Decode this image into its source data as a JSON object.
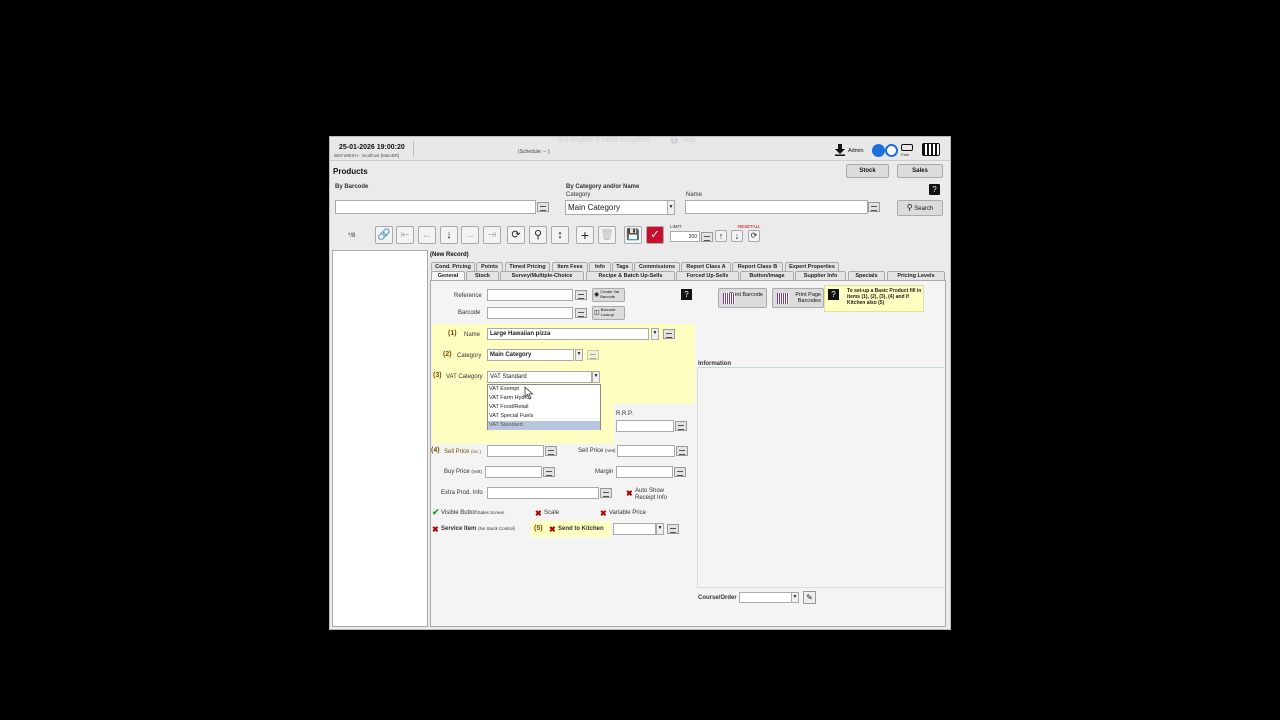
{
  "header": {
    "datetime": "25-01-2026 19:00:20",
    "terminal": "IBM-W9ISH - localhost [MainBR]",
    "schedule": "(Schedule: -- )",
    "language": "EN English (United Kingdom)",
    "help": "Help",
    "admin": "Admin",
    "park": "Park"
  },
  "page": {
    "title": "Products",
    "stock_btn": "Stock",
    "sales_btn": "Sales"
  },
  "search": {
    "by_barcode": "By Barcode",
    "by_category_or_name": "By Category and/or Name",
    "category_label": "Category",
    "category_value": "Main Category",
    "name_label": "Name",
    "search_btn": "Search"
  },
  "toolbar": {
    "record_count": "*/8",
    "limit_label": "LIMIT",
    "limit_value": "200",
    "reset_all": "RESETALL"
  },
  "record": {
    "title": "(New Record)"
  },
  "tabs_row1": [
    "Cond. Pricing",
    "Points",
    "Timed Pricing",
    "Item Fees",
    "Info",
    "Tags",
    "Commissions",
    "Report Class A",
    "Report Class B",
    "Expert Properties"
  ],
  "tabs_row2": [
    "General",
    "Stock",
    "Survey/Multiple-Choice",
    "Recipe & Batch Up-Sells",
    "Forced Up-Sells",
    "Button/Image",
    "Supplier Info",
    "Specials",
    "Pricing Levels"
  ],
  "form": {
    "reference_label": "Reference",
    "barcode_label": "Barcode",
    "create_var_barcode": "Create Var Barcode",
    "barcode_lookup": "Barcode Lookup",
    "n1": "(1)",
    "name_label": "Name",
    "name_value": "Large Hawaiian pizza",
    "n2": "(2)",
    "category_label": "Category",
    "category_value": "Main Category",
    "n3": "(3)",
    "vat_label": "VAT Category",
    "vat_value": "VAT Standard",
    "vat_options": [
      "VAT Exempt",
      "VAT Farm Hydro",
      "VAT Food/Retail",
      "VAT Special Fuels",
      "VAT Standard"
    ],
    "rrp_label": "R.R.P.",
    "n4": "(4)",
    "sell_price_inc_label": "Sell Price",
    "sell_price_inc_suffix": "(inc.)",
    "sell_price_net_label": "Sell Price",
    "sell_price_net_suffix": "(nett)",
    "buy_price_label": "Buy Price",
    "buy_price_suffix": "(nett)",
    "margin_label": "Margin",
    "extra_prod_info_label": "Extra Prod. Info",
    "auto_show_receipt": "Auto Show Receipt Info",
    "visible_button": "Visible Button",
    "visible_button_suffix": "Sales Screen",
    "scale": "Scale",
    "variable_price": "Variable Price",
    "service_item": "Service Item",
    "service_item_suffix": "(No Stock Control)",
    "n5": "(5)",
    "send_to_kitchen": "Send to Kitchen",
    "print_barcode": "Print Barcode",
    "print_page_barcodes": "Print Page Barcodes",
    "hint": "To set-up a Basic Product fill in items (1), (2), (3), (4) and if Kitchen also (5)",
    "information_label": "Information",
    "course_order_label": "Course/Order"
  }
}
